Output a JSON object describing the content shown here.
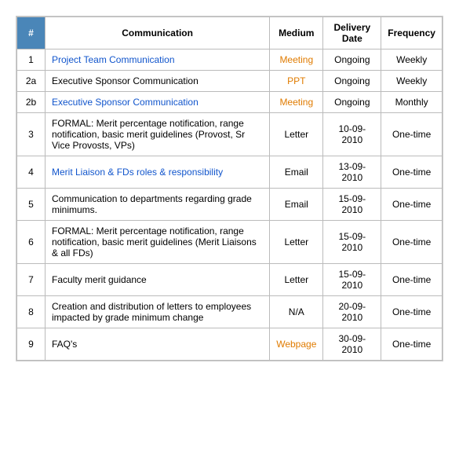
{
  "table": {
    "headers": [
      "#",
      "Communication",
      "Medium",
      "Delivery Date",
      "Frequency"
    ],
    "rows": [
      {
        "num": "1",
        "communication": "Project Team Communication",
        "comm_style": "link",
        "medium": "Meeting",
        "medium_style": "meeting",
        "date": "Ongoing",
        "frequency": "Weekly"
      },
      {
        "num": "2a",
        "communication": "Executive Sponsor Communication",
        "comm_style": "normal",
        "medium": "PPT",
        "medium_style": "ppt",
        "date": "Ongoing",
        "frequency": "Weekly"
      },
      {
        "num": "2b",
        "communication": "Executive Sponsor Communication",
        "comm_style": "link",
        "medium": "Meeting",
        "medium_style": "meeting",
        "date": "Ongoing",
        "frequency": "Monthly"
      },
      {
        "num": "3",
        "communication": "FORMAL: Merit percentage notification, range notification, basic merit guidelines (Provost, Sr Vice Provosts, VPs)",
        "comm_style": "normal",
        "medium": "Letter",
        "medium_style": "letter",
        "date": "10-09-2010",
        "frequency": "One-time"
      },
      {
        "num": "4",
        "communication": "Merit Liaison & FDs roles & responsibility",
        "comm_style": "link",
        "medium": "Email",
        "medium_style": "email",
        "date": "13-09-2010",
        "frequency": "One-time"
      },
      {
        "num": "5",
        "communication": "Communication to departments regarding grade minimums.",
        "comm_style": "normal",
        "medium": "Email",
        "medium_style": "email",
        "date": "15-09-2010",
        "frequency": "One-time"
      },
      {
        "num": "6",
        "communication": "FORMAL: Merit percentage notification, range notification, basic merit guidelines (Merit Liaisons & all FDs)",
        "comm_style": "normal",
        "medium": "Letter",
        "medium_style": "letter",
        "date": "15-09-2010",
        "frequency": "One-time"
      },
      {
        "num": "7",
        "communication": "Faculty merit guidance",
        "comm_style": "normal",
        "medium": "Letter",
        "medium_style": "letter",
        "date": "15-09-2010",
        "frequency": "One-time"
      },
      {
        "num": "8",
        "communication": "Creation and distribution of letters to employees impacted by grade minimum change",
        "comm_style": "normal",
        "medium": "N/A",
        "medium_style": "na",
        "date": "20-09-2010",
        "frequency": "One-time"
      },
      {
        "num": "9",
        "communication": "FAQ's",
        "comm_style": "normal",
        "medium": "Webpage",
        "medium_style": "webpage",
        "date": "30-09-2010",
        "frequency": "One-time"
      }
    ]
  }
}
